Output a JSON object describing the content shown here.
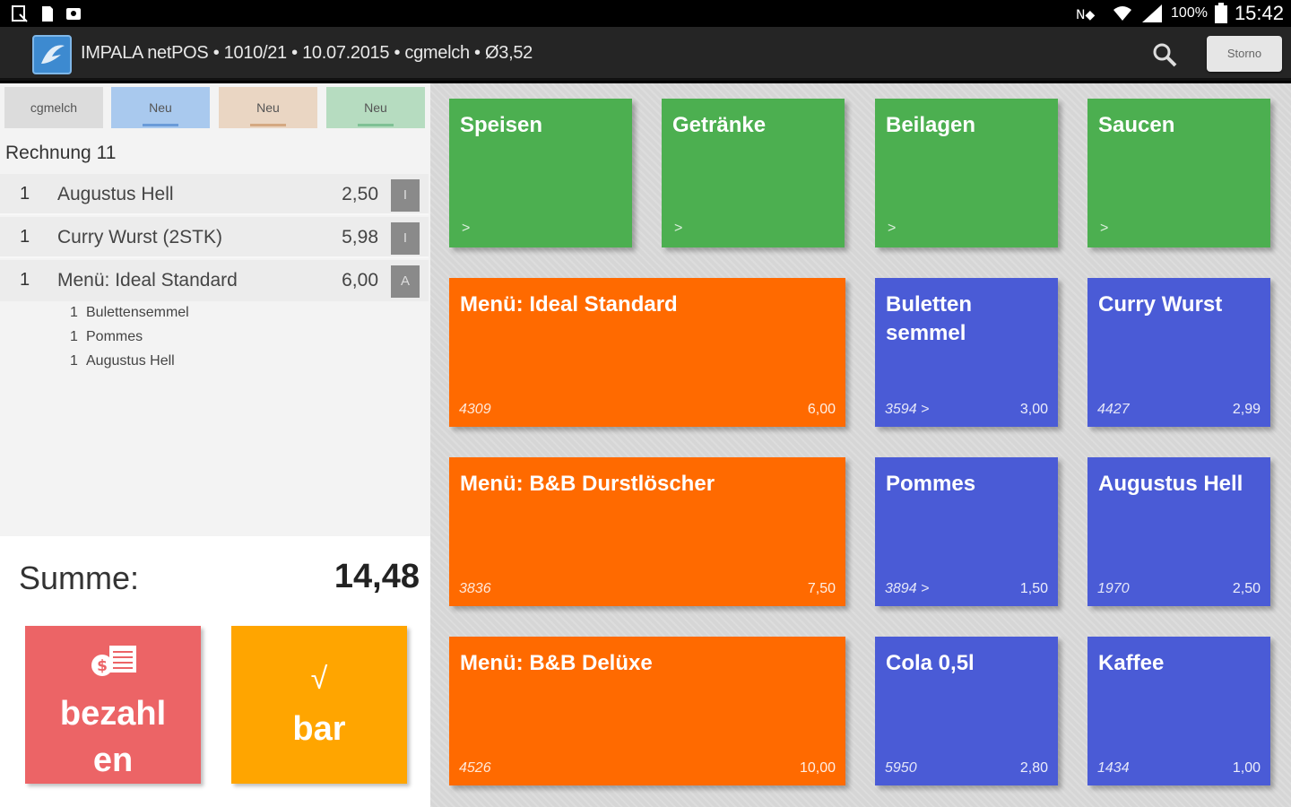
{
  "status_bar": {
    "battery": "100%",
    "time": "15:42"
  },
  "action_bar": {
    "title": "IMPALA netPOS • 1010/21 • 10.07.2015 • cgmelch • Ø3,52",
    "storno_label": "Storno"
  },
  "tabs": [
    {
      "label": "cgmelch"
    },
    {
      "label": "Neu"
    },
    {
      "label": "Neu"
    },
    {
      "label": "Neu"
    }
  ],
  "invoice": {
    "title": "Rechnung 11",
    "items": [
      {
        "qty": "1",
        "name": "Augustus Hell",
        "price": "2,50",
        "tag": "I"
      },
      {
        "qty": "1",
        "name": "Curry Wurst (2STK)",
        "price": "5,98",
        "tag": "I"
      },
      {
        "qty": "1",
        "name": "Menü: Ideal Standard",
        "price": "6,00",
        "tag": "A"
      }
    ],
    "sub_items": [
      {
        "qty": "1",
        "name": "Bulettensemmel"
      },
      {
        "qty": "1",
        "name": "Pommes"
      },
      {
        "qty": "1",
        "name": "Augustus Hell"
      }
    ],
    "sum_label": "Summe:",
    "sum_value": "14,48",
    "pay_label_1": "bezahl",
    "pay_label_2": "en",
    "cash_check": "√",
    "cash_label": "bar"
  },
  "categories": [
    {
      "name": "Speisen",
      "arrow": ">"
    },
    {
      "name": "Getränke",
      "arrow": ">"
    },
    {
      "name": "Beilagen",
      "arrow": ">"
    },
    {
      "name": "Saucen",
      "arrow": ">"
    }
  ],
  "products": [
    {
      "name": "Menü: Ideal Standard",
      "code": "4309",
      "price": "6,00"
    },
    {
      "name": "Buletten semmel",
      "code": "3594 >",
      "price": "3,00"
    },
    {
      "name": "Curry Wurst",
      "code": "4427",
      "price": "2,99"
    },
    {
      "name": "Menü: B&B Durstlöscher",
      "code": "3836",
      "price": "7,50"
    },
    {
      "name": "Pommes",
      "code": "3894 >",
      "price": "1,50"
    },
    {
      "name": "Augustus Hell",
      "code": "1970",
      "price": "2,50"
    },
    {
      "name": "Menü: B&B Delüxe",
      "code": "4526",
      "price": "10,00"
    },
    {
      "name": "Cola 0,5l",
      "code": "5950",
      "price": "2,80"
    },
    {
      "name": "Kaffee",
      "code": "1434",
      "price": "1,00"
    }
  ],
  "colors": {
    "category_green": "#4caf50",
    "menu_orange": "#ff6a00",
    "product_blue": "#4a5bd6",
    "pay_red": "#ec6466",
    "cash_orange": "#ffa500"
  }
}
